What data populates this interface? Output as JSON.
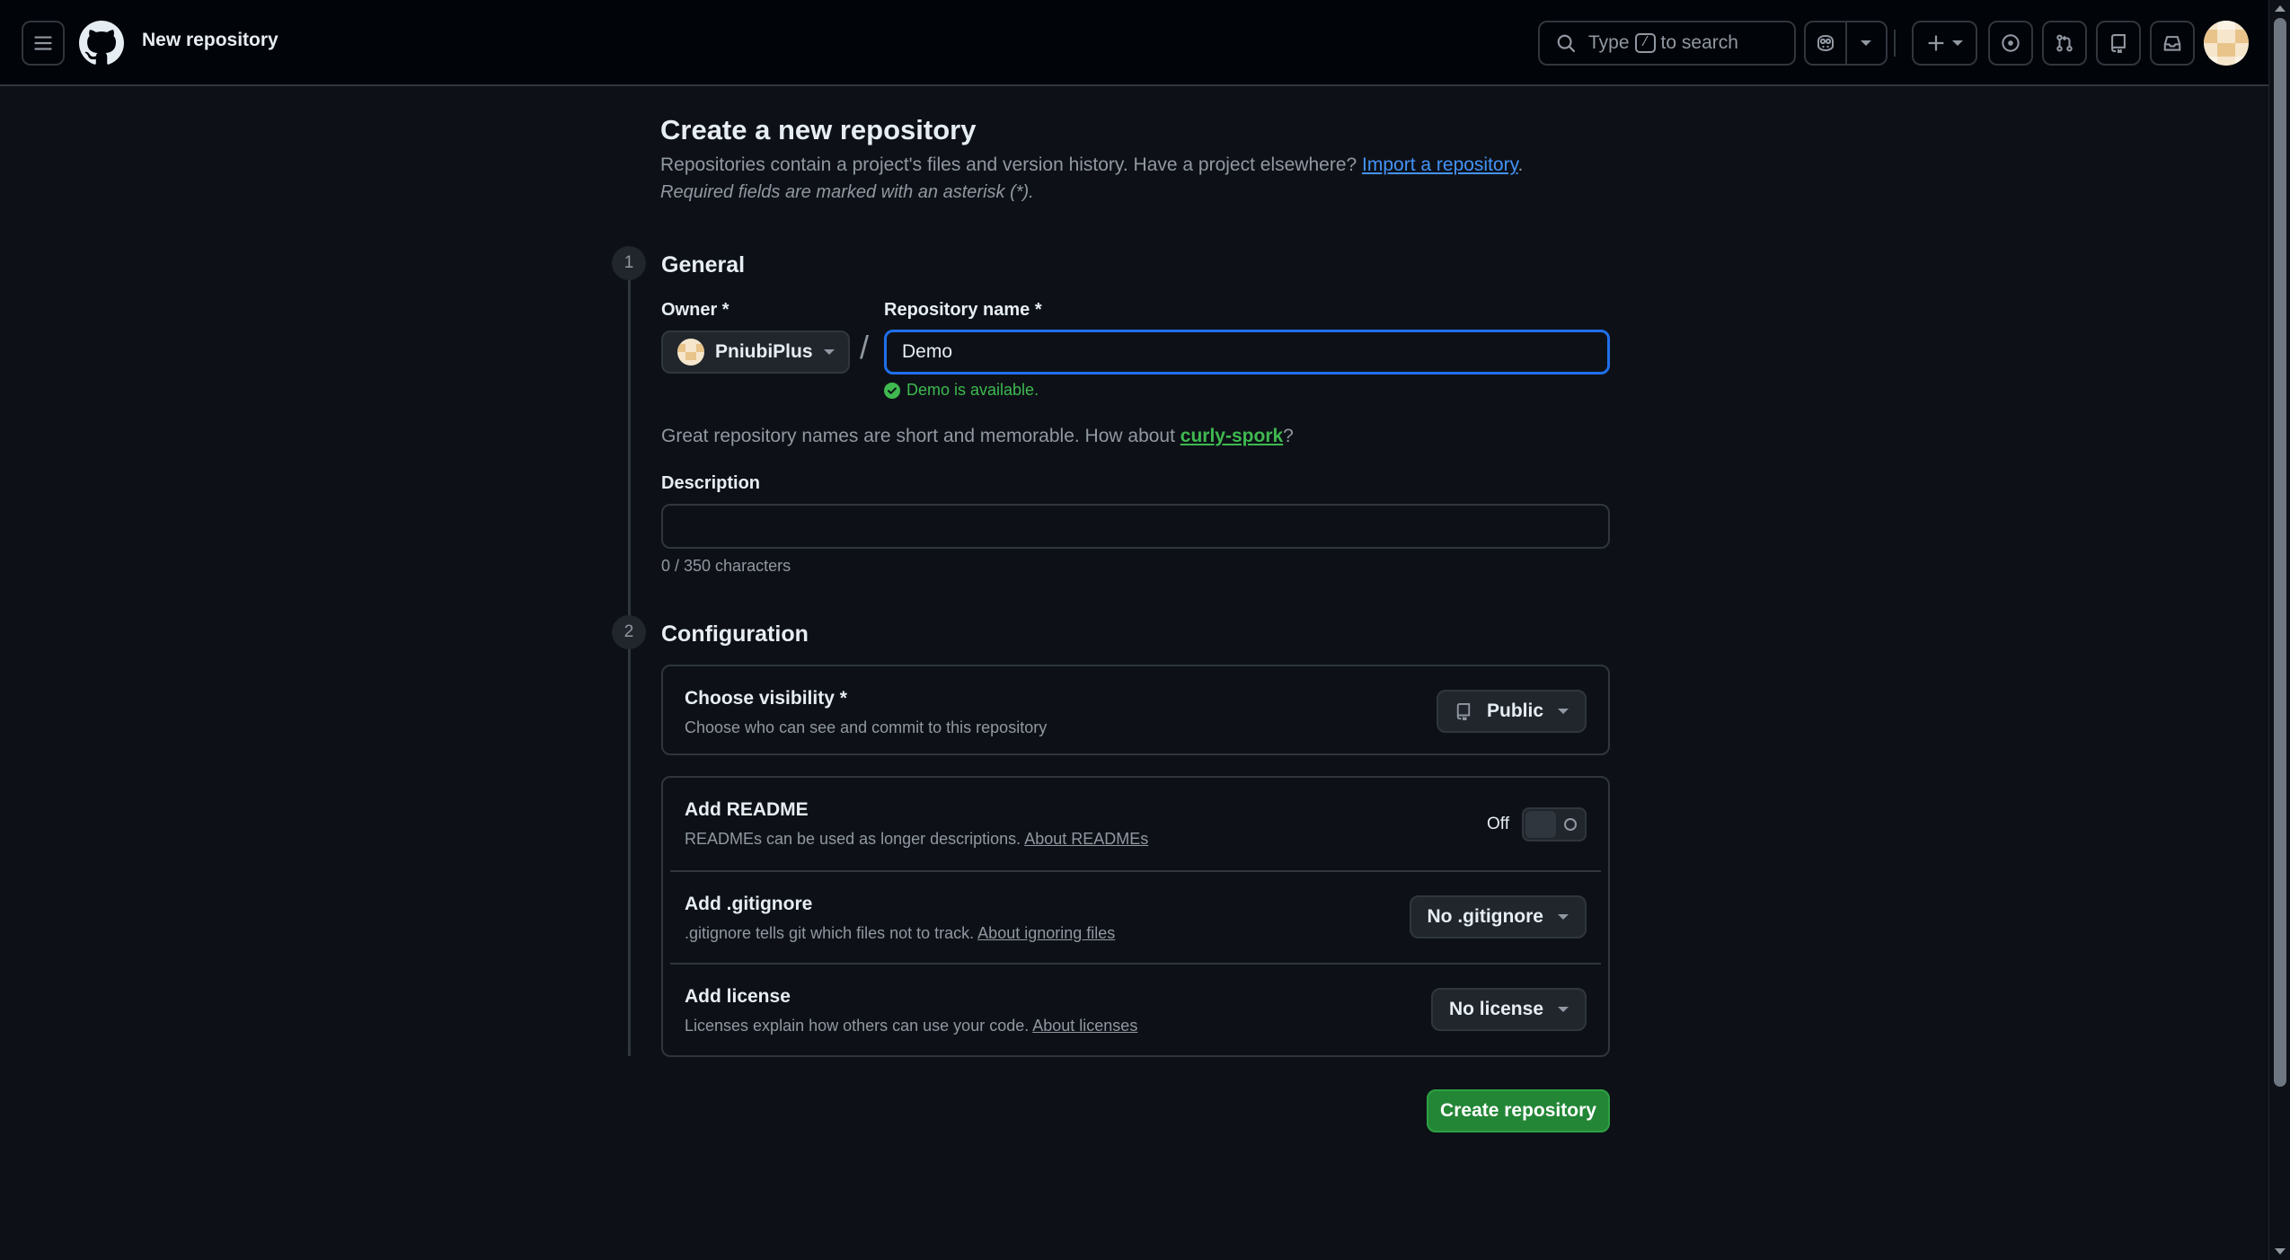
{
  "header": {
    "page_name": "New repository",
    "search": {
      "prefix": "Type",
      "key": "/",
      "suffix": "to search"
    }
  },
  "main": {
    "title": "Create a new repository",
    "intro": "Repositories contain a project's files and version history. Have a project elsewhere?",
    "import_link": "Import a repository",
    "intro_end": ".",
    "required_note": "Required fields are marked with an asterisk (*)."
  },
  "general": {
    "step": "1",
    "title": "General",
    "owner_label": "Owner *",
    "owner_value": "PniubiPlus",
    "separator": "/",
    "name_label": "Repository name *",
    "name_value": "Demo",
    "availability": "Demo is available.",
    "suggestion_prefix": "Great repository names are short and memorable. How about",
    "suggestion_name": "curly-spork",
    "suggestion_suffix": "?",
    "description_label": "Description",
    "description_value": "",
    "char_count": "0 / 350 characters"
  },
  "configuration": {
    "step": "2",
    "title": "Configuration",
    "visibility": {
      "title": "Choose visibility *",
      "desc": "Choose who can see and commit to this repository",
      "value": "Public"
    },
    "readme": {
      "title": "Add README",
      "desc": "READMEs can be used as longer descriptions.",
      "link": "About READMEs",
      "state": "Off"
    },
    "gitignore": {
      "title": "Add .gitignore",
      "desc": ".gitignore tells git which files not to track.",
      "link": "About ignoring files",
      "value": "No .gitignore"
    },
    "license": {
      "title": "Add license",
      "desc": "Licenses explain how others can use your code.",
      "link": "About licenses",
      "value": "No license"
    }
  },
  "actions": {
    "create": "Create repository"
  },
  "colors": {
    "accent": "#1f6feb",
    "success": "#3fb950",
    "create_button": "#238636",
    "background": "#0d1117"
  }
}
